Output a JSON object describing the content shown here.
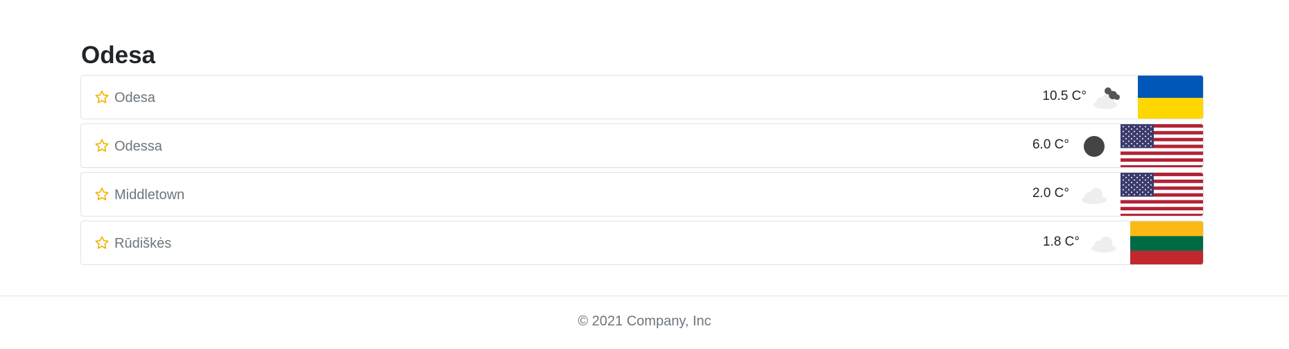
{
  "page": {
    "title": "Odesa"
  },
  "results": [
    {
      "city": "Odesa",
      "temperature": "10.5 C°",
      "weather_icon": "partly-cloudy-night-icon",
      "flag": "flag-ukraine-icon"
    },
    {
      "city": "Odessa",
      "temperature": "6.0 C°",
      "weather_icon": "clear-night-icon",
      "flag": "flag-usa-icon"
    },
    {
      "city": "Middletown",
      "temperature": "2.0 C°",
      "weather_icon": "cloud-icon",
      "flag": "flag-usa-icon"
    },
    {
      "city": "Rūdiškės",
      "temperature": "1.8 C°",
      "weather_icon": "cloud-icon",
      "flag": "flag-lithuania-icon"
    }
  ],
  "footer": {
    "copyright": "© 2021 Company, Inc"
  },
  "colors": {
    "star": "#f0b400",
    "ukraine_blue": "#0057b7",
    "ukraine_yellow": "#ffd700",
    "usa_red": "#b22234",
    "usa_blue": "#3c3b6e",
    "lithuania_yellow": "#fdb913",
    "lithuania_green": "#006a44",
    "lithuania_red": "#c1272d"
  }
}
